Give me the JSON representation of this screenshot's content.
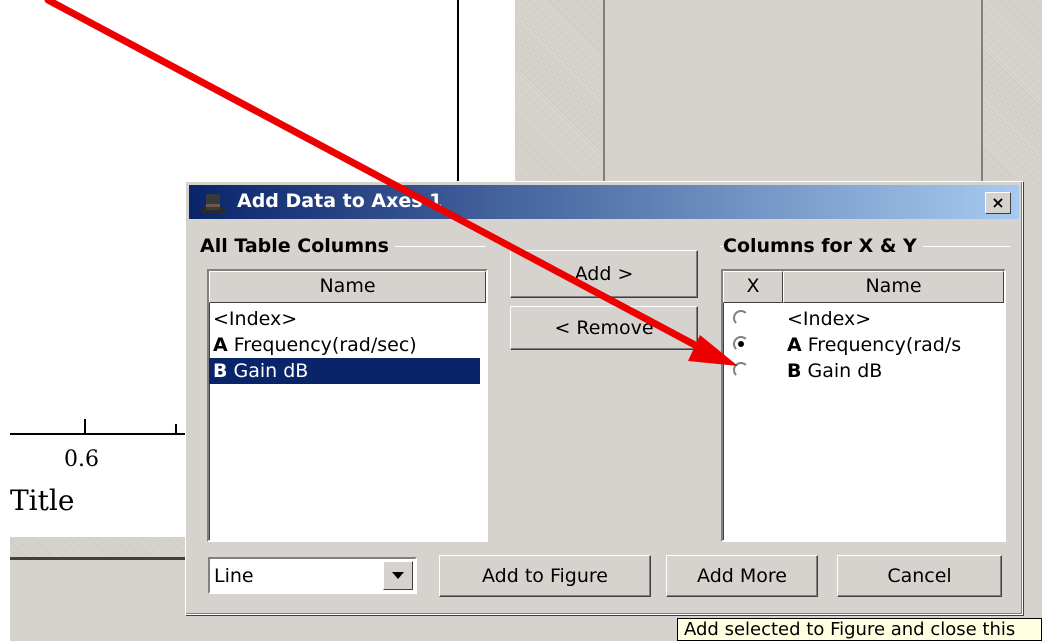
{
  "background": {
    "tick_label": "0.6",
    "axis_title": "Title"
  },
  "dialog": {
    "title": "Add Data to Axes 1",
    "close_label": "×",
    "left_group": {
      "label": "All Table Columns",
      "column_header": "Name",
      "rows": [
        {
          "prefix": "",
          "label": "<Index>",
          "selected": false
        },
        {
          "prefix": "A",
          "label": " Frequency(rad/sec)",
          "selected": false
        },
        {
          "prefix": "B",
          "label": " Gain dB",
          "selected": true
        }
      ]
    },
    "buttons": {
      "add": "Add >",
      "remove": "< Remove",
      "add_to_figure": "Add to Figure",
      "add_more": "Add More",
      "cancel": "Cancel"
    },
    "right_group": {
      "label": "Columns for X & Y",
      "column_x_header": "X",
      "column_name_header": "Name",
      "rows": [
        {
          "prefix": "",
          "label": "<Index>",
          "checked": false
        },
        {
          "prefix": "A",
          "label": " Frequency(rad/s",
          "checked": true
        },
        {
          "prefix": "B",
          "label": " Gain dB",
          "checked": false
        }
      ]
    },
    "plot_type": {
      "selected": "Line"
    }
  },
  "tooltip": "Add selected to Figure and close this",
  "colors": {
    "annotation_arrow": "#ee0000",
    "selection": "#0a246a",
    "titlebar_start": "#0a246a",
    "titlebar_end": "#a6caf0"
  }
}
